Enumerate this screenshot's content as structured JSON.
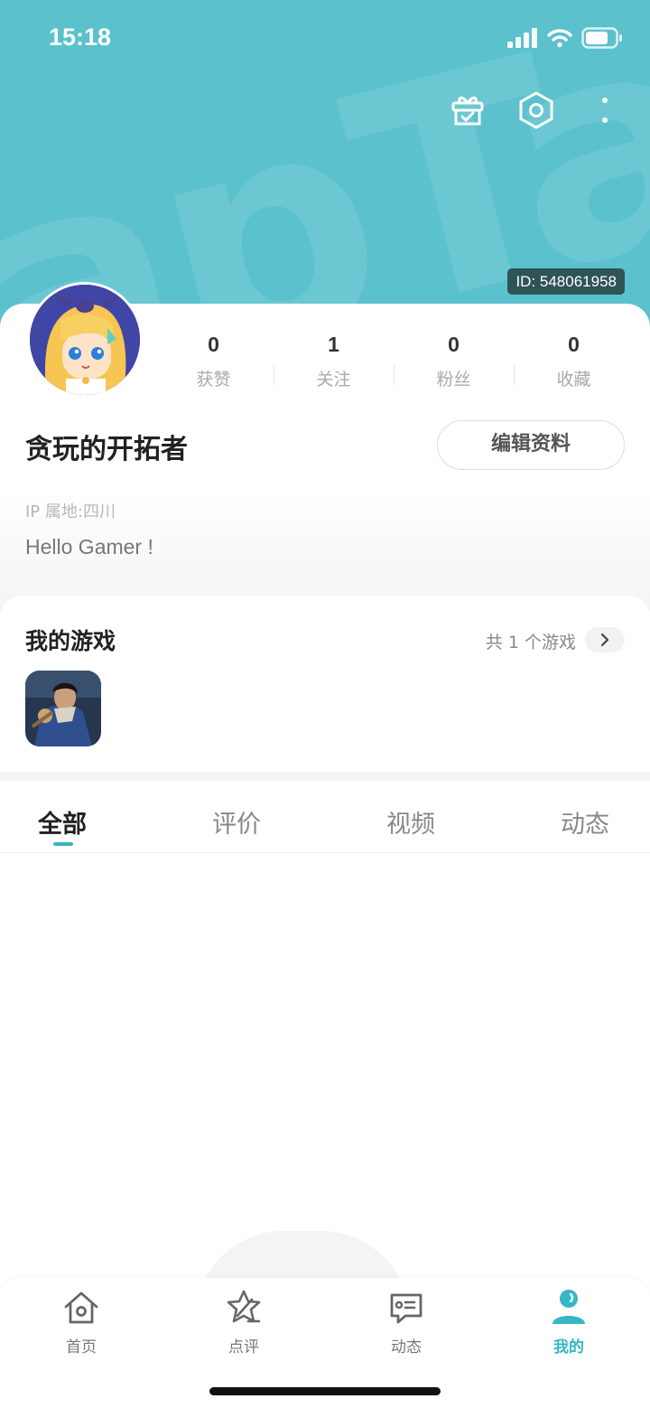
{
  "status_bar": {
    "time": "15:18"
  },
  "header": {
    "watermark": "apTap",
    "user_id": "ID: 548061958"
  },
  "stats": [
    {
      "value": "0",
      "label": "获赞"
    },
    {
      "value": "1",
      "label": "关注"
    },
    {
      "value": "0",
      "label": "粉丝"
    },
    {
      "value": "0",
      "label": "收藏"
    }
  ],
  "profile": {
    "nickname": "贪玩的开拓者",
    "edit_label": "编辑资料",
    "ip_location": "IP 属地:四川",
    "bio": "Hello Gamer !"
  },
  "my_games": {
    "title": "我的游戏",
    "count_text": "共 1 个游戏"
  },
  "tabs": [
    {
      "label": "全部",
      "active": true
    },
    {
      "label": "评价",
      "active": false
    },
    {
      "label": "视频",
      "active": false
    },
    {
      "label": "动态",
      "active": false
    }
  ],
  "bottom_nav": [
    {
      "label": "首页",
      "icon": "home-icon",
      "active": false
    },
    {
      "label": "点评",
      "icon": "review-pen-icon",
      "active": false
    },
    {
      "label": "动态",
      "icon": "feed-message-icon",
      "active": false
    },
    {
      "label": "我的",
      "icon": "profile-person-icon",
      "active": true
    }
  ],
  "colors": {
    "accent": "#37b6c6",
    "header_bg": "#5bc1cc",
    "id_badge_bg": "#2f5458"
  }
}
